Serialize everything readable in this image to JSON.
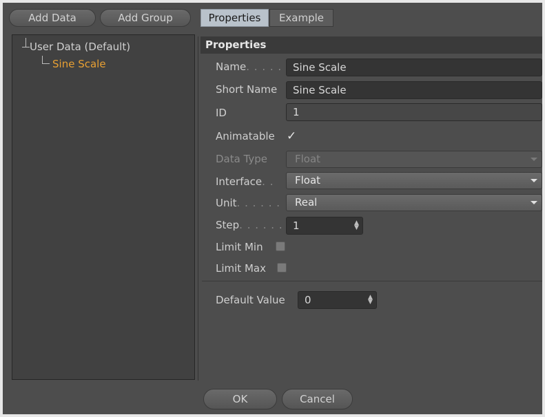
{
  "toolbar": {
    "add_data": "Add Data",
    "add_group": "Add Group"
  },
  "tree": {
    "root": "User Data (Default)",
    "child": "Sine Scale",
    "child_color": "#e8a033"
  },
  "tabs": {
    "properties": "Properties",
    "example": "Example"
  },
  "header": "Properties",
  "fields": {
    "name_label": "Name",
    "name_dots": ". . . . .",
    "name_value": "Sine Scale",
    "short_name_label": "Short Name",
    "short_name_value": "Sine Scale",
    "id_label": "ID",
    "id_value": "1",
    "animatable_label": "Animatable",
    "animatable_check": "✓",
    "data_type_label": "Data Type",
    "data_type_value": "Float",
    "interface_label": "Interface",
    "interface_dots": ". .",
    "interface_value": "Float",
    "unit_label": "Unit",
    "unit_dots": ". . . . . .",
    "unit_value": "Real",
    "step_label": "Step",
    "step_dots": ". . . . . .",
    "step_value": "1",
    "limit_min_label": "Limit Min",
    "limit_max_label": "Limit Max",
    "default_value_label": "Default Value",
    "default_value": "0"
  },
  "footer": {
    "ok": "OK",
    "cancel": "Cancel"
  }
}
